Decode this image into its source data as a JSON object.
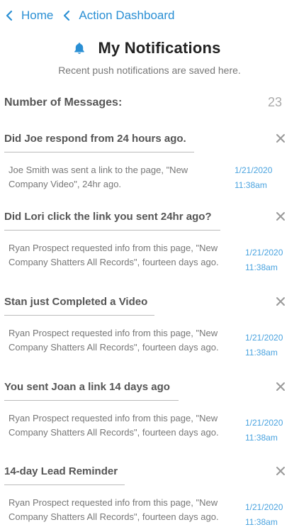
{
  "breadcrumb": {
    "home_label": "Home",
    "current_label": "Action Dashboard"
  },
  "header": {
    "icon": "bell-icon",
    "title": "My Notifications",
    "subtitle": "Recent push notifications are saved here."
  },
  "summary": {
    "label": "Number of Messages:",
    "count": "23"
  },
  "colors": {
    "accent": "#2a8fd4",
    "timestamp": "#4aa3df",
    "heading_text": "#555555",
    "body_text": "#777777",
    "close_icon": "#999999"
  },
  "notifications": [
    {
      "title": "Did Joe respond from 24 hours ago.",
      "body": "Joe Smith was sent a link to the page, \"New Company Video\", 24hr ago.",
      "date": "1/21/2020",
      "time": "11:38am"
    },
    {
      "title": "Did Lori click the link you sent 24hr ago?",
      "body": "Ryan Prospect requested info from this page, \"New Company Shatters All Records\", fourteen days ago.",
      "date": "1/21/2020",
      "time": "11:38am"
    },
    {
      "title": "Stan just Completed a Video",
      "body": "Ryan Prospect requested info from this page, \"New Company Shatters All Records\", fourteen days ago.",
      "date": "1/21/2020",
      "time": "11:38am"
    },
    {
      "title": "You sent Joan a link 14 days ago",
      "body": "Ryan Prospect requested info from this page, \"New Company Shatters All Records\", fourteen days ago.",
      "date": "1/21/2020",
      "time": "11:38am"
    },
    {
      "title": "14-day Lead Reminder",
      "body": "Ryan Prospect requested info from this page, \"New Company Shatters All Records\", fourteen days ago.",
      "date": "1/21/2020",
      "time": "11:38am"
    }
  ]
}
